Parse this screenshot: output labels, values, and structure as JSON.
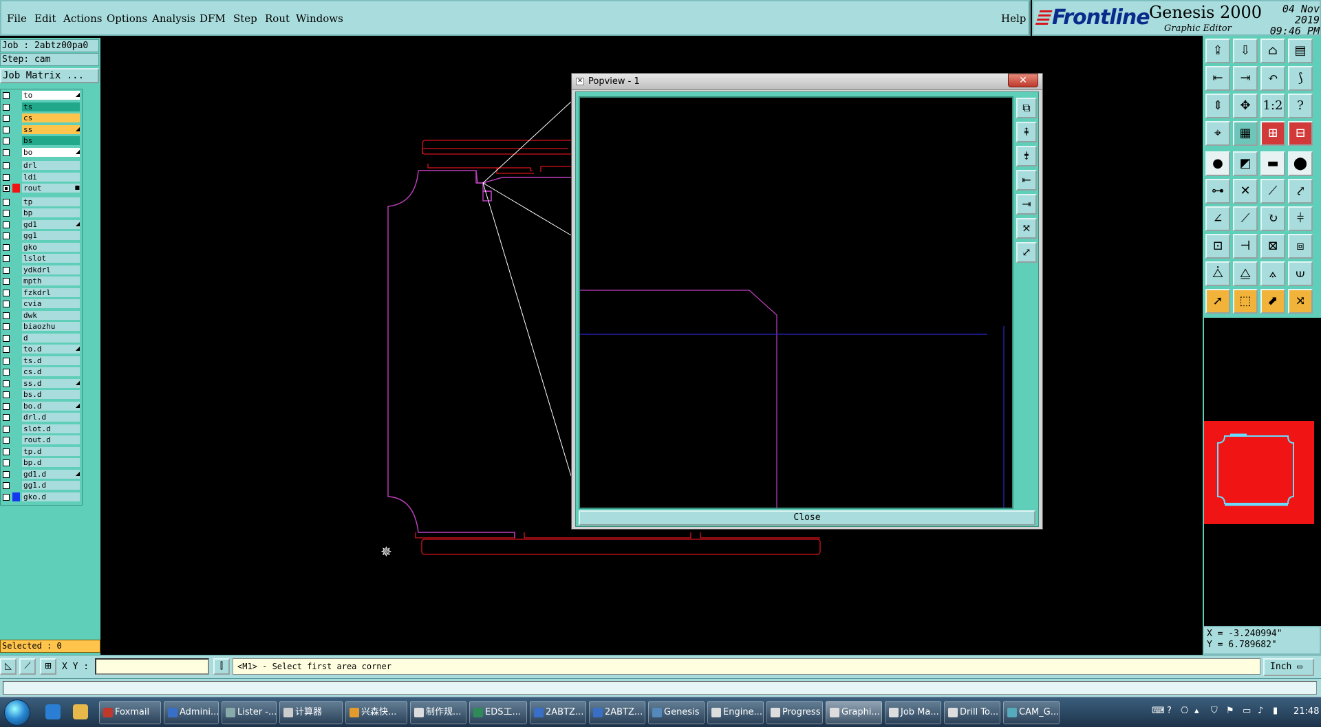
{
  "menubar": {
    "items": [
      "File",
      "Edit",
      "Actions",
      "Options",
      "Analysis",
      "DFM",
      "Step",
      "Rout",
      "Windows"
    ],
    "help": "Help"
  },
  "brand": {
    "logo": "Frontline",
    "product": "Genesis 2000",
    "subtitle": "Graphic Editor",
    "date": "04 Nov 2019",
    "time": "09:46 PM"
  },
  "leftpanel": {
    "job": "Job : 2abtz00pa0",
    "step": "Step: cam",
    "job_matrix": "Job Matrix ...",
    "selected": "Selected : 0",
    "layers": [
      {
        "name": "to",
        "color": "#ffffff",
        "mark": "◢"
      },
      {
        "name": "ts",
        "color": "#21a88a",
        "mark": ""
      },
      {
        "name": "cs",
        "color": "#ffc44c",
        "mark": ""
      },
      {
        "name": "ss",
        "color": "#ffc44c",
        "mark": "◢"
      },
      {
        "name": "bs",
        "color": "#21a88a",
        "mark": ""
      },
      {
        "name": "bo",
        "color": "#ffffff",
        "mark": "◢"
      },
      {
        "name": "drl",
        "color": "#a9dcdc",
        "mark": ""
      },
      {
        "name": "ldi",
        "color": "#a9dcdc",
        "mark": ""
      },
      {
        "name": "rout",
        "color": "#a9dcdc",
        "mark": "■",
        "active": true
      },
      {
        "name": "tp",
        "color": "#a9dcdc",
        "mark": ""
      },
      {
        "name": "bp",
        "color": "#a9dcdc",
        "mark": ""
      },
      {
        "name": "gd1",
        "color": "#a9dcdc",
        "mark": "◢"
      },
      {
        "name": "gg1",
        "color": "#a9dcdc",
        "mark": ""
      },
      {
        "name": "gko",
        "color": "#a9dcdc",
        "mark": ""
      },
      {
        "name": "lslot",
        "color": "#a9dcdc",
        "mark": ""
      },
      {
        "name": "ydkdrl",
        "color": "#a9dcdc",
        "mark": ""
      },
      {
        "name": "mpth",
        "color": "#a9dcdc",
        "mark": ""
      },
      {
        "name": "fzkdrl",
        "color": "#a9dcdc",
        "mark": ""
      },
      {
        "name": "cvia",
        "color": "#a9dcdc",
        "mark": ""
      },
      {
        "name": "dwk",
        "color": "#a9dcdc",
        "mark": ""
      },
      {
        "name": "biaozhu",
        "color": "#a9dcdc",
        "mark": ""
      },
      {
        "name": "d",
        "color": "#a9dcdc",
        "mark": ""
      },
      {
        "name": "to.d",
        "color": "#a9dcdc",
        "mark": "◢"
      },
      {
        "name": "ts.d",
        "color": "#a9dcdc",
        "mark": ""
      },
      {
        "name": "cs.d",
        "color": "#a9dcdc",
        "mark": ""
      },
      {
        "name": "ss.d",
        "color": "#a9dcdc",
        "mark": "◢"
      },
      {
        "name": "bs.d",
        "color": "#a9dcdc",
        "mark": ""
      },
      {
        "name": "bo.d",
        "color": "#a9dcdc",
        "mark": "◢"
      },
      {
        "name": "drl.d",
        "color": "#a9dcdc",
        "mark": ""
      },
      {
        "name": "slot.d",
        "color": "#a9dcdc",
        "mark": ""
      },
      {
        "name": "rout.d",
        "color": "#a9dcdc",
        "mark": ""
      },
      {
        "name": "tp.d",
        "color": "#a9dcdc",
        "mark": ""
      },
      {
        "name": "bp.d",
        "color": "#a9dcdc",
        "mark": ""
      },
      {
        "name": "gd1.d",
        "color": "#a9dcdc",
        "mark": "◢"
      },
      {
        "name": "gg1.d",
        "color": "#a9dcdc",
        "mark": ""
      },
      {
        "name": "gko.d",
        "color": "#a9dcdc",
        "mark": ""
      }
    ]
  },
  "popview": {
    "title": "Popview - 1",
    "close_x": "✕",
    "close_label": "Close"
  },
  "coords": {
    "x": "X = -3.240994\"",
    "y": "Y = 6.789682\""
  },
  "command": {
    "xy_label": "X Y :",
    "xy_value": "",
    "prompt": "<M1> - Select first area corner",
    "units": "Inch ▭"
  },
  "taskbar": {
    "tasks": [
      {
        "label": "Foxmail",
        "color": "#c0392b"
      },
      {
        "label": "Admini...",
        "color": "#3a6fc7"
      },
      {
        "label": "Lister -...",
        "color": "#8aa"
      },
      {
        "label": "计算器",
        "color": "#ccc"
      },
      {
        "label": "兴森快...",
        "color": "#e39b2d"
      },
      {
        "label": "制作规...",
        "color": "#ddd"
      },
      {
        "label": "EDS工...",
        "color": "#2e8b57"
      },
      {
        "label": "2ABTZ...",
        "color": "#3a6fc7"
      },
      {
        "label": "2ABTZ...",
        "color": "#3a6fc7"
      },
      {
        "label": "Genesis",
        "color": "#58b"
      },
      {
        "label": "Engine...",
        "color": "#ddd"
      },
      {
        "label": "Progress",
        "color": "#ddd"
      },
      {
        "label": "Graphi...",
        "color": "#ddd",
        "active": true
      },
      {
        "label": "Job Ma...",
        "color": "#ddd"
      },
      {
        "label": "Drill To...",
        "color": "#ddd"
      },
      {
        "label": "CAM_G...",
        "color": "#5ab"
      }
    ],
    "clock": "21:48"
  }
}
